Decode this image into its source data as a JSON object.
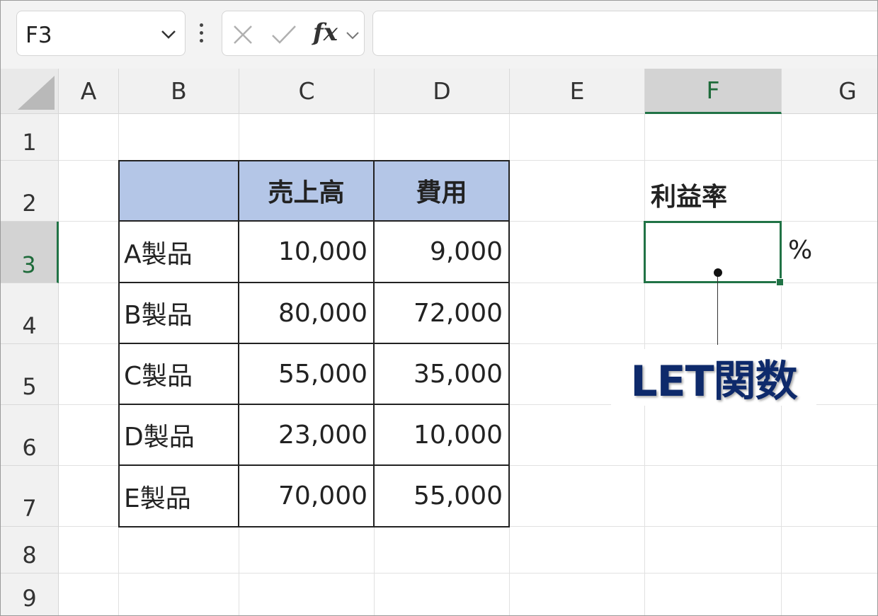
{
  "formula_bar": {
    "name_box": "F3",
    "fx_label": "fx",
    "formula": ""
  },
  "columns": [
    "A",
    "B",
    "C",
    "D",
    "E",
    "F",
    "G"
  ],
  "rows": [
    "1",
    "2",
    "3",
    "4",
    "5",
    "6",
    "7",
    "8",
    "9"
  ],
  "active_cell": {
    "column": "F",
    "row": "3"
  },
  "table": {
    "headers": [
      "",
      "売上高",
      "費用"
    ],
    "rows": [
      [
        "A製品",
        "10,000",
        "9,000"
      ],
      [
        "B製品",
        "80,000",
        "72,000"
      ],
      [
        "C製品",
        "55,000",
        "35,000"
      ],
      [
        "D製品",
        "23,000",
        "10,000"
      ],
      [
        "E製品",
        "70,000",
        "55,000"
      ]
    ]
  },
  "profit_rate": {
    "label": "利益率",
    "value": "",
    "unit": "%"
  },
  "callout": "LET関数",
  "colors": {
    "header_fill": "#b4c6e7",
    "selection": "#217346",
    "callout_text": "#0e2a6b"
  }
}
